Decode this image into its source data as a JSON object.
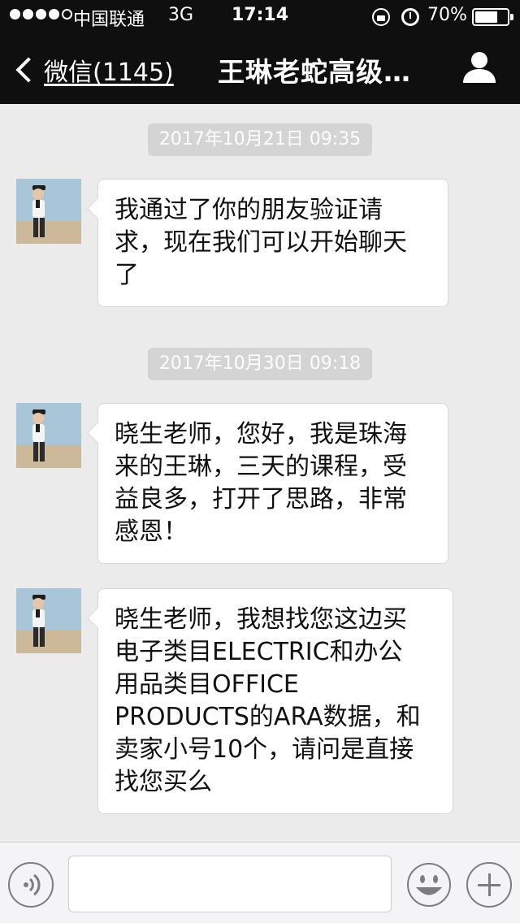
{
  "status_bar": {
    "signal_dots": "●●●●○",
    "carrier": "中国联通",
    "network": "3G",
    "time": "17:14",
    "battery_percent": "70%",
    "battery_level": 0.7,
    "icons": [
      "orientation-lock-icon",
      "alarm-icon",
      "battery-icon"
    ]
  },
  "nav": {
    "back_label": "微信(1145)",
    "title": "王琳老蛇高级…",
    "right_icon": "profile-icon"
  },
  "messages": [
    {
      "timestamp": "2017年10月21日 09:35",
      "lines": [
        "我通过了你的朋友验证请",
        "求，现在我们可以开始聊天",
        "了"
      ]
    },
    {
      "timestamp": "2017年10月30日 09:18",
      "lines": [
        "晓生老师，您好，我是珠海",
        "来的王琳，三天的课程，受",
        "益良多，打开了思路，非常",
        "感恩！"
      ]
    },
    {
      "timestamp": "",
      "lines": [
        "晓生老师，我想找您这边买",
        "电子类目ELECTRIC和办公",
        "用品类目OFFICE",
        "PRODUCTS的ARA数据，和",
        "卖家小号10个，请问是直接",
        "找您买么"
      ]
    }
  ],
  "input_bar": {
    "voice_icon": "voice-icon",
    "emoji_icon": "emoji-icon",
    "plus_icon": "plus-icon"
  },
  "colors": {
    "header_bg": "#0f0f0f",
    "chat_bg": "#ebebeb",
    "timestamp_bg": "#d4d4d4",
    "bubble_bg": "#ffffff"
  }
}
